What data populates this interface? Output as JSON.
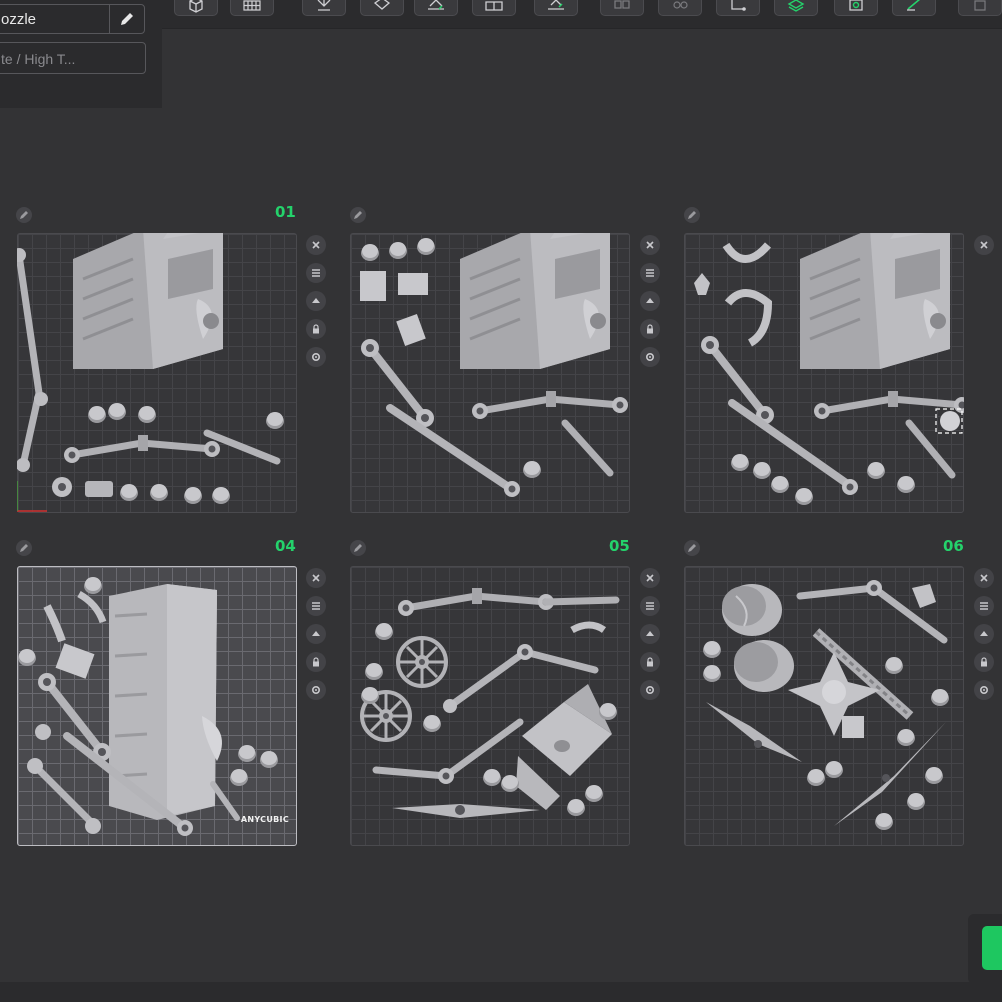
{
  "printer": {
    "name": "ozzle",
    "plate_type": "te / High T..."
  },
  "toolbar": {
    "buttons": [
      "cube-icon",
      "grid-icon",
      "arrange-icon",
      "orient-icon",
      "lay-flat-icon",
      "split-icon",
      "place-on-face-icon",
      "assembly-icon",
      "variable-layer-icon",
      "measure-icon",
      "support-paint-icon",
      "seam-paint-icon",
      "color-paint-icon",
      "more-icon"
    ]
  },
  "plates": [
    {
      "label": "01",
      "selected": false
    },
    {
      "label": "",
      "selected": false
    },
    {
      "label": "",
      "selected": false
    },
    {
      "label": "04",
      "selected": true
    },
    {
      "label": "05",
      "selected": false
    },
    {
      "label": "06",
      "selected": false
    }
  ],
  "brand": "ANYCUBIC",
  "colors": {
    "background": "#333335",
    "accent": "#24d26b",
    "part": "#a9a9ad"
  }
}
